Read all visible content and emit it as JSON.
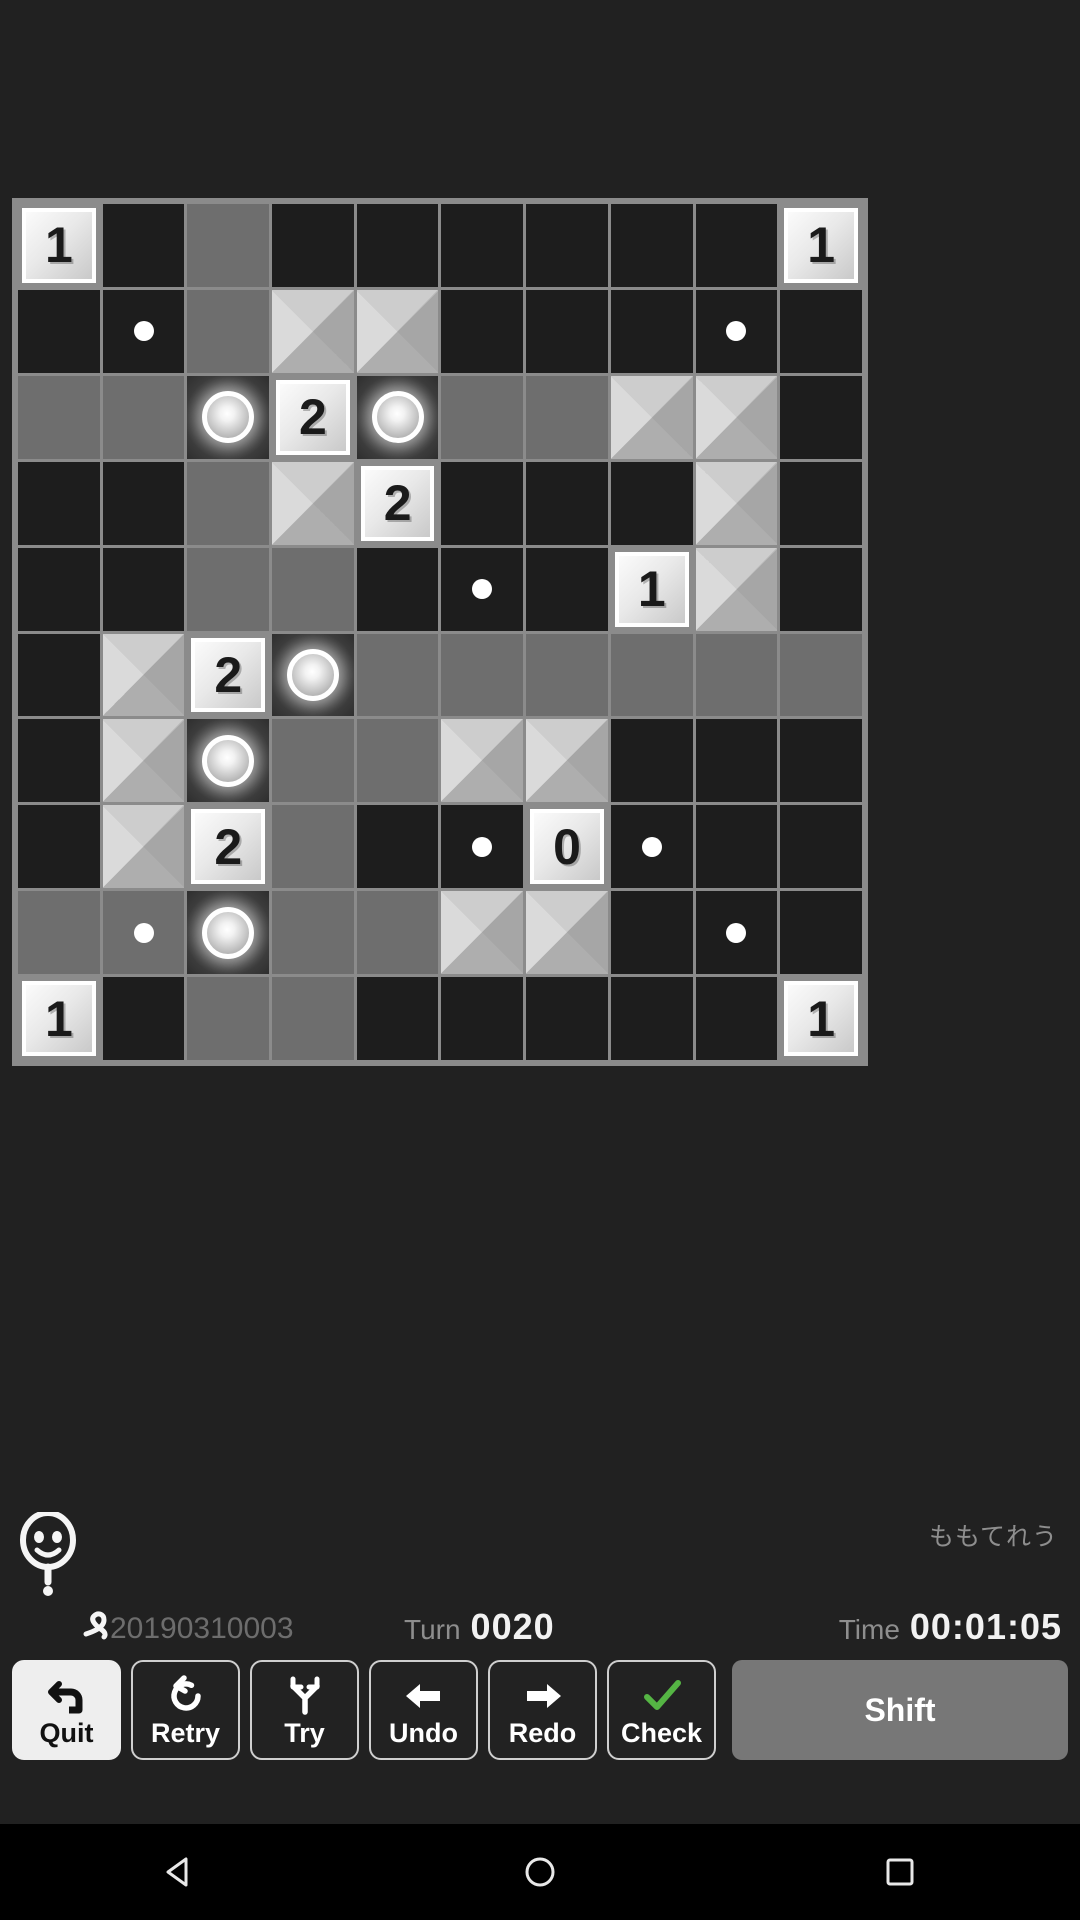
{
  "app": {
    "background_color": "#212121",
    "board_frame_color": "#8b8b8b"
  },
  "board": {
    "rows": 10,
    "cols": 10,
    "legend": {
      "dark": "unlit dark cell",
      "gray": "lit / gray cell",
      "xlight": "light beveled cross cell",
      "clue": "numbered clue tile",
      "dot": "dark cell with white dot marker",
      "ring": "cell containing a glowing lamp ring"
    },
    "cells": [
      [
        {
          "t": "clue",
          "v": "1"
        },
        {
          "t": "dark"
        },
        {
          "t": "gray"
        },
        {
          "t": "dark"
        },
        {
          "t": "dark"
        },
        {
          "t": "dark"
        },
        {
          "t": "dark"
        },
        {
          "t": "dark"
        },
        {
          "t": "dark"
        },
        {
          "t": "clue",
          "v": "1"
        }
      ],
      [
        {
          "t": "dark"
        },
        {
          "t": "dot"
        },
        {
          "t": "gray"
        },
        {
          "t": "xlight"
        },
        {
          "t": "xlight"
        },
        {
          "t": "dark"
        },
        {
          "t": "dark"
        },
        {
          "t": "dark"
        },
        {
          "t": "dot"
        },
        {
          "t": "dark"
        }
      ],
      [
        {
          "t": "gray"
        },
        {
          "t": "gray"
        },
        {
          "t": "ring"
        },
        {
          "t": "clue",
          "v": "2"
        },
        {
          "t": "ring"
        },
        {
          "t": "gray"
        },
        {
          "t": "gray"
        },
        {
          "t": "xlight"
        },
        {
          "t": "xlight"
        },
        {
          "t": "dark"
        }
      ],
      [
        {
          "t": "dark"
        },
        {
          "t": "dark"
        },
        {
          "t": "gray"
        },
        {
          "t": "xlight"
        },
        {
          "t": "clue",
          "v": "2"
        },
        {
          "t": "dark"
        },
        {
          "t": "dark"
        },
        {
          "t": "dark"
        },
        {
          "t": "xlight"
        },
        {
          "t": "dark"
        }
      ],
      [
        {
          "t": "dark"
        },
        {
          "t": "dark"
        },
        {
          "t": "gray"
        },
        {
          "t": "gray"
        },
        {
          "t": "dark"
        },
        {
          "t": "dot"
        },
        {
          "t": "dark"
        },
        {
          "t": "clue",
          "v": "1"
        },
        {
          "t": "xlight"
        },
        {
          "t": "dark"
        }
      ],
      [
        {
          "t": "dark"
        },
        {
          "t": "xlight"
        },
        {
          "t": "clue",
          "v": "2"
        },
        {
          "t": "ring"
        },
        {
          "t": "gray"
        },
        {
          "t": "gray"
        },
        {
          "t": "gray"
        },
        {
          "t": "gray"
        },
        {
          "t": "gray"
        },
        {
          "t": "gray"
        }
      ],
      [
        {
          "t": "dark"
        },
        {
          "t": "xlight"
        },
        {
          "t": "ring"
        },
        {
          "t": "gray"
        },
        {
          "t": "gray"
        },
        {
          "t": "xlight"
        },
        {
          "t": "xlight"
        },
        {
          "t": "dark"
        },
        {
          "t": "dark"
        },
        {
          "t": "dark"
        }
      ],
      [
        {
          "t": "dark"
        },
        {
          "t": "xlight"
        },
        {
          "t": "clue",
          "v": "2"
        },
        {
          "t": "gray"
        },
        {
          "t": "dark"
        },
        {
          "t": "dot"
        },
        {
          "t": "clue",
          "v": "0"
        },
        {
          "t": "dot"
        },
        {
          "t": "dark"
        },
        {
          "t": "dark"
        }
      ],
      [
        {
          "t": "gray"
        },
        {
          "t": "dot-gray"
        },
        {
          "t": "ring"
        },
        {
          "t": "gray"
        },
        {
          "t": "gray"
        },
        {
          "t": "xlight"
        },
        {
          "t": "xlight"
        },
        {
          "t": "dark"
        },
        {
          "t": "dot"
        },
        {
          "t": "dark"
        }
      ],
      [
        {
          "t": "clue",
          "v": "1"
        },
        {
          "t": "dark"
        },
        {
          "t": "gray"
        },
        {
          "t": "gray"
        },
        {
          "t": "dark"
        },
        {
          "t": "dark"
        },
        {
          "t": "dark"
        },
        {
          "t": "dark"
        },
        {
          "t": "dark"
        },
        {
          "t": "clue",
          "v": "1"
        }
      ]
    ]
  },
  "status": {
    "nickname": "ももてれう",
    "puzzle_id": "20190310003",
    "turn_label": "Turn",
    "turn_value": "0020",
    "time_label": "Time",
    "time_value": "00:01:05"
  },
  "toolbar": {
    "buttons": [
      {
        "label": "Quit",
        "icon": "undo-arrow-icon",
        "style": "primary"
      },
      {
        "label": "Retry",
        "icon": "refresh-icon",
        "style": "normal"
      },
      {
        "label": "Try",
        "icon": "branch-icon",
        "style": "normal"
      },
      {
        "label": "Undo",
        "icon": "arrow-left-icon",
        "style": "normal"
      },
      {
        "label": "Redo",
        "icon": "arrow-right-icon",
        "style": "normal"
      },
      {
        "label": "Check",
        "icon": "checkmark-icon",
        "style": "normal",
        "icon_color": "#55b544"
      }
    ],
    "shift_label": "Shift"
  },
  "navbar": {
    "back": "back-triangle-icon",
    "home": "home-circle-icon",
    "recents": "recents-square-icon"
  }
}
